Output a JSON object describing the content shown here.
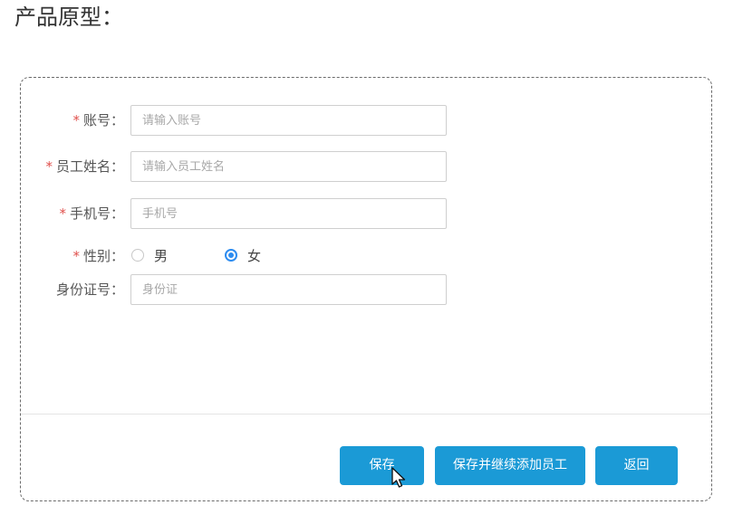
{
  "page": {
    "heading": "产品原型："
  },
  "form": {
    "account": {
      "required": "*",
      "label": "账号：",
      "placeholder": "请输入账号"
    },
    "employee_name": {
      "required": "*",
      "label": "员工姓名：",
      "placeholder": "请输入员工姓名"
    },
    "phone": {
      "required": "*",
      "label": "手机号：",
      "placeholder": "手机号"
    },
    "gender": {
      "required": "*",
      "label": "性别：",
      "options": [
        "男",
        "女"
      ],
      "selected": "女"
    },
    "id_number": {
      "label": "身份证号：",
      "placeholder": "身份证"
    }
  },
  "actions": {
    "save_label": "保存",
    "save_continue_label": "保存并继续添加员工",
    "back_label": "返回"
  },
  "colors": {
    "primary_button": "#1b9ad6",
    "required_star": "#e0504c",
    "radio_checked": "#2d8cf0"
  },
  "icons": {
    "cursor": "mouse-pointer-icon"
  }
}
